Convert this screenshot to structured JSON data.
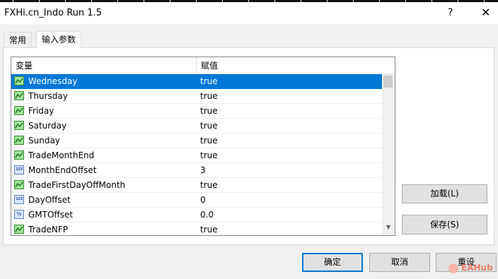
{
  "window": {
    "title": "FXHi.cn_Indo Run 1.5",
    "help": "?",
    "close": "✕"
  },
  "tabs": [
    {
      "label": "常用"
    },
    {
      "label": "输入参数"
    }
  ],
  "grid": {
    "headers": {
      "variable": "变量",
      "value": "赋值"
    },
    "rows": [
      {
        "name": "Wednesday",
        "value": "true",
        "icon": "bool-param-icon"
      },
      {
        "name": "Thursday",
        "value": "true",
        "icon": "bool-param-icon"
      },
      {
        "name": "Friday",
        "value": "true",
        "icon": "bool-param-icon"
      },
      {
        "name": "Saturday",
        "value": "true",
        "icon": "bool-param-icon"
      },
      {
        "name": "Sunday",
        "value": "true",
        "icon": "bool-param-icon"
      },
      {
        "name": "TradeMonthEnd",
        "value": "true",
        "icon": "bool-param-icon"
      },
      {
        "name": "MonthEndOffset",
        "value": "3",
        "icon": "int-param-icon",
        "icon_text": "123"
      },
      {
        "name": "TradeFirstDayOffMonth",
        "value": "true",
        "icon": "bool-param-icon"
      },
      {
        "name": "DayOffset",
        "value": "0",
        "icon": "int-param-icon",
        "icon_text": "123"
      },
      {
        "name": "GMTOffset",
        "value": "0.0",
        "icon": "double-param-icon",
        "icon_text": "½"
      },
      {
        "name": "TradeNFP",
        "value": "true",
        "icon": "bool-param-icon"
      }
    ]
  },
  "buttons": {
    "load": "加载(L)",
    "save": "保存(S)",
    "ok": "确定",
    "cancel": "取消",
    "reset": "重设"
  },
  "watermark": "EAHub",
  "colors": {
    "selection": "#0078d7",
    "default_button_border": "#0078d7"
  }
}
